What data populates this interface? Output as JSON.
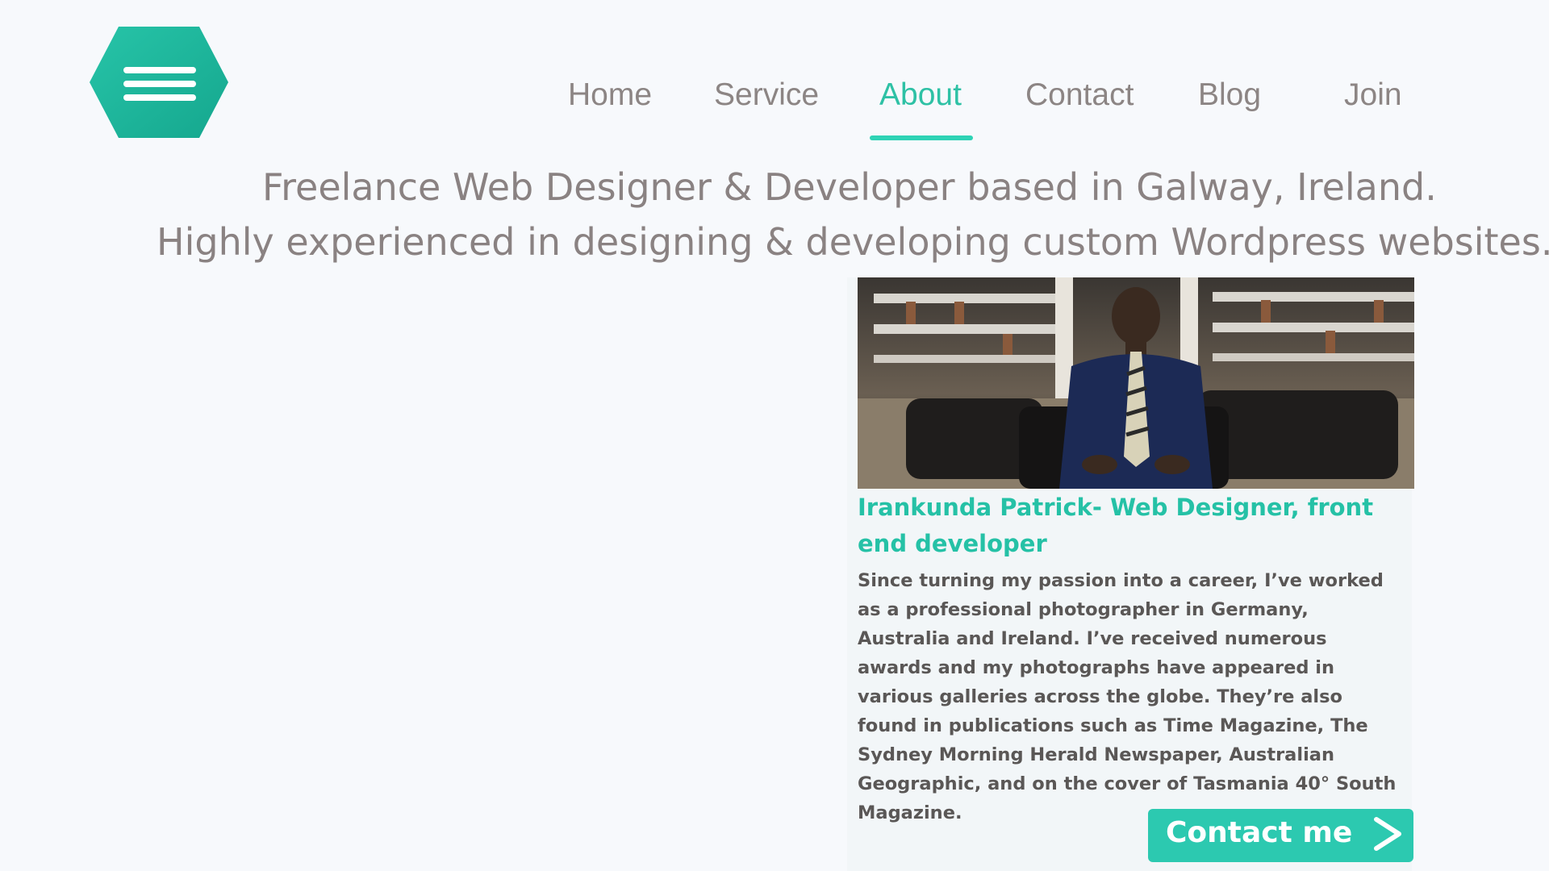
{
  "brand": {
    "logo_icon": "hamburger-menu-hexagon-icon",
    "accent_color": "#2ec1a5"
  },
  "nav": {
    "items": [
      {
        "label": "Home",
        "active": false
      },
      {
        "label": "Service",
        "active": false
      },
      {
        "label": "About",
        "active": true
      },
      {
        "label": "Contact",
        "active": false
      },
      {
        "label": "Blog",
        "active": false
      },
      {
        "label": "Join",
        "active": false
      }
    ]
  },
  "hero": {
    "line1": "Freelance Web Designer & Developer based in Galway, Ireland.",
    "line2": "Highly experienced in designing & developing custom Wordpress websites."
  },
  "profile": {
    "name": "Irankunda Patrick- Web Designer, front end developer",
    "bio": "Since turning my passion into a career, I’ve worked as a professional photographer in Germany, Australia and Ireland. I’ve received numerous awards and my photographs have appeared in various galleries across the globe. They’re also found in publications such as Time Magazine, The Sydney Morning Herald Newspaper, Australian Geographic, and on the cover of Tasmania 40° South Magazine.",
    "contact_label": "Contact me",
    "contact_icon": "chevron-right-icon"
  }
}
